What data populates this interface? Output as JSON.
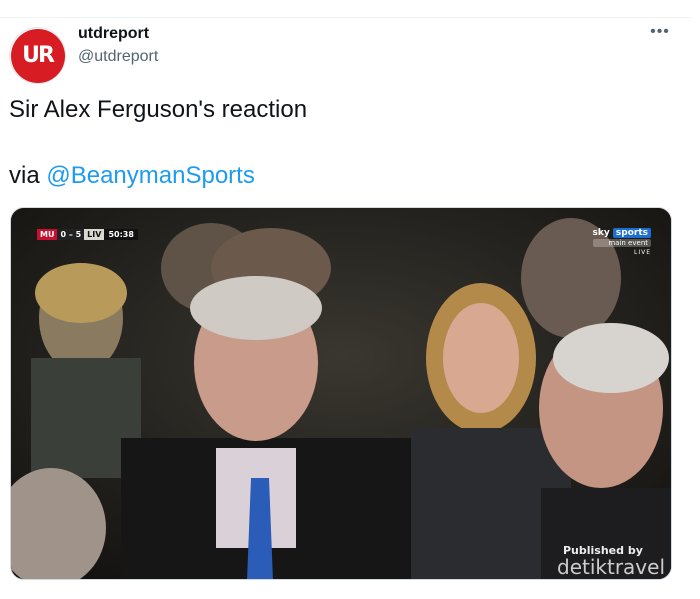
{
  "tweet": {
    "author": {
      "display_name": "utdreport",
      "handle": "@utdreport",
      "avatar_monogram": "UR",
      "avatar_color": "#d81c24"
    },
    "more_label": "•••",
    "text_line1": "Sir Alex Ferguson's reaction",
    "via_label": "via",
    "mention": "@BeanymanSports",
    "mention_color": "#1d9bf0"
  },
  "media": {
    "scorebug": {
      "home": "MU",
      "score": "0 – 5",
      "away": "LIV",
      "clock": "50:38"
    },
    "broadcaster": {
      "brand_prefix": "sky",
      "brand_suffix": "sports",
      "event": "main event",
      "live": "LIVE"
    },
    "watermark": {
      "published_by": "Published by",
      "brand": "detiktravel"
    }
  }
}
